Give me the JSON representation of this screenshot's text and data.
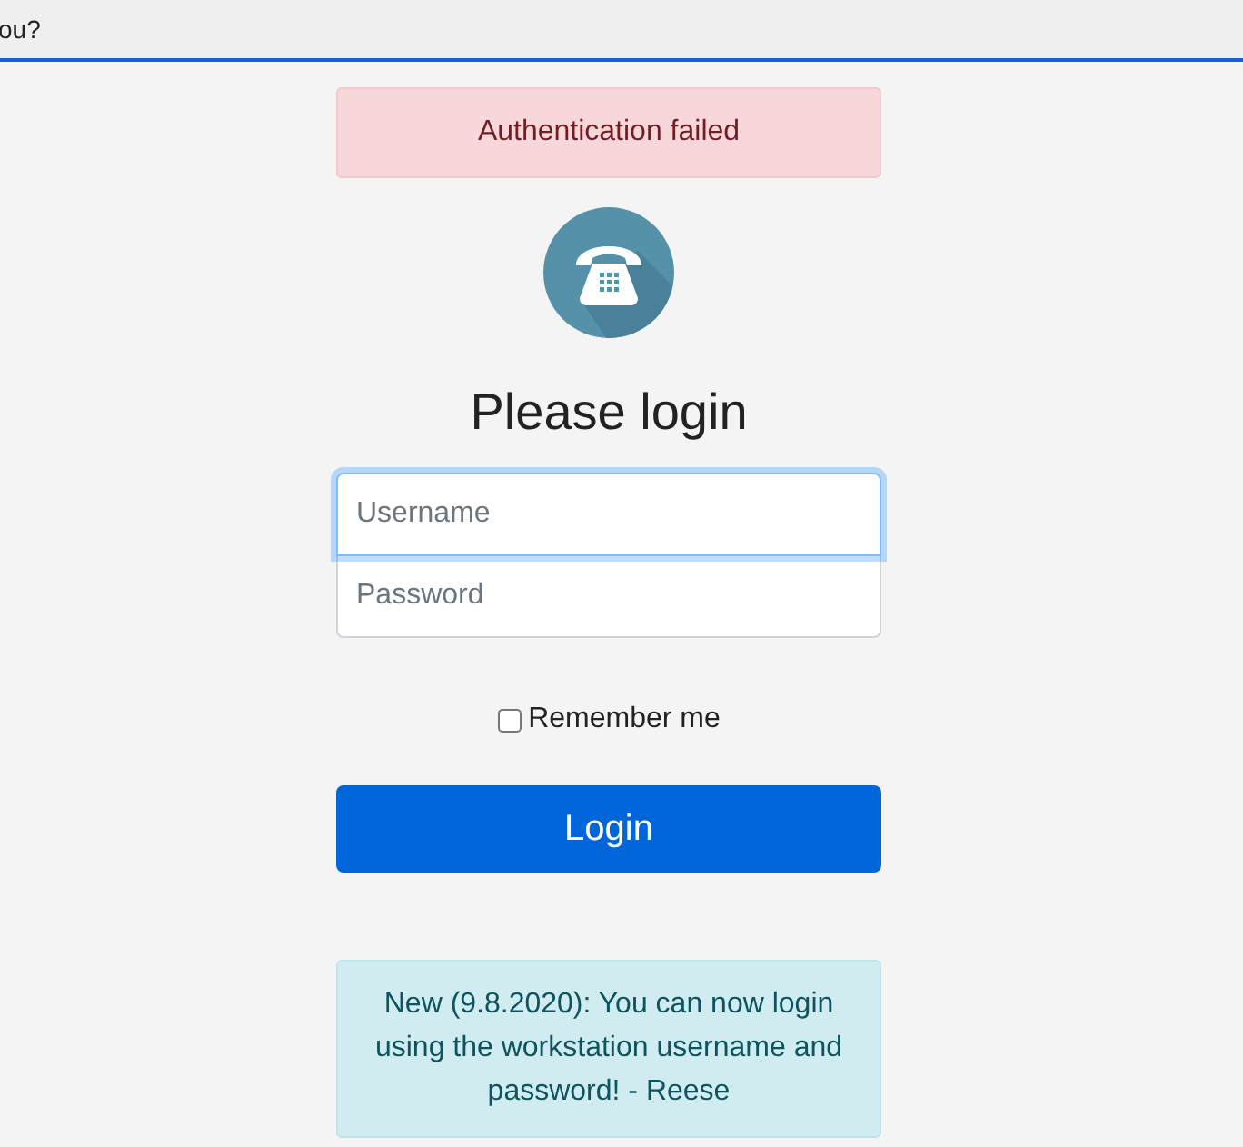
{
  "top_bar": {
    "text": "ou?"
  },
  "alert": {
    "text": "Authentication failed"
  },
  "title": "Please login",
  "fields": [
    {
      "placeholder": "Username",
      "focused": true
    },
    {
      "placeholder": "Password",
      "focused": false
    }
  ],
  "remember": {
    "label": "Remember me",
    "checked": false
  },
  "login_button": "Login",
  "notice": {
    "text": "New (9.8.2020): You can now login using the workstation username and password! - Reese"
  }
}
